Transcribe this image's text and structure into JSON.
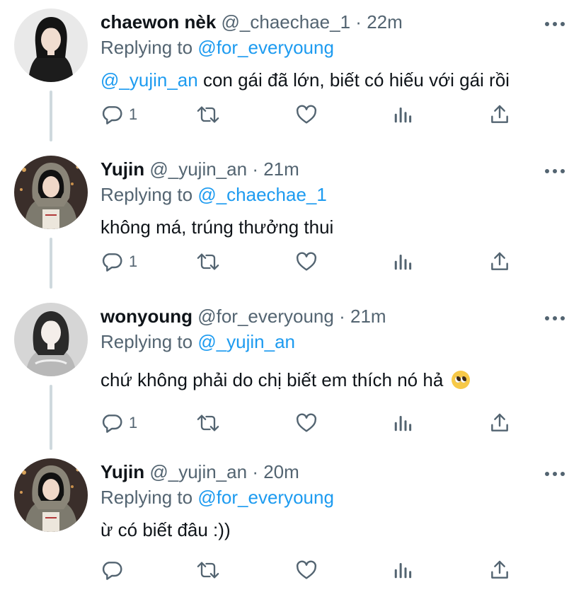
{
  "colors": {
    "link": "#1d9bf0",
    "muted": "#536471",
    "text": "#0f1419",
    "thread_line": "#cfd9de"
  },
  "tweets": [
    {
      "name": "chaewon nèk",
      "handle": "@_chaechae_1",
      "dot": "·",
      "time": "22m",
      "replying_prefix": "Replying to ",
      "replying_to": "@for_everyoung",
      "mention": "@_yujin_an",
      "text": " con gái đã lớn, biết có hiếu với gái rồi",
      "reply_count": "1",
      "avatar": "avatar-chaewon"
    },
    {
      "name": "Yujin",
      "handle": "@_yujin_an",
      "dot": "·",
      "time": "21m",
      "replying_prefix": "Replying to ",
      "replying_to": "@_chaechae_1",
      "mention": "",
      "text": "không má, trúng thưởng thui",
      "reply_count": "1",
      "avatar": "avatar-yujin"
    },
    {
      "name": "wonyoung",
      "handle": "@for_everyoung",
      "dot": "·",
      "time": "21m",
      "replying_prefix": "Replying to ",
      "replying_to": "@_yujin_an",
      "mention": "",
      "text": "chứ không phải do chị biết em thích nó hả",
      "emoji": "pleading-face-emoji",
      "reply_count": "1",
      "avatar": "avatar-wonyoung"
    },
    {
      "name": "Yujin",
      "handle": "@_yujin_an",
      "dot": "·",
      "time": "20m",
      "replying_prefix": "Replying to ",
      "replying_to": "@for_everyoung",
      "mention": "",
      "text": "ừ có biết đâu :))",
      "reply_count": "",
      "avatar": "avatar-yujin"
    }
  ],
  "action_icons": [
    "reply-icon",
    "retweet-icon",
    "like-icon",
    "analytics-icon",
    "share-icon"
  ]
}
